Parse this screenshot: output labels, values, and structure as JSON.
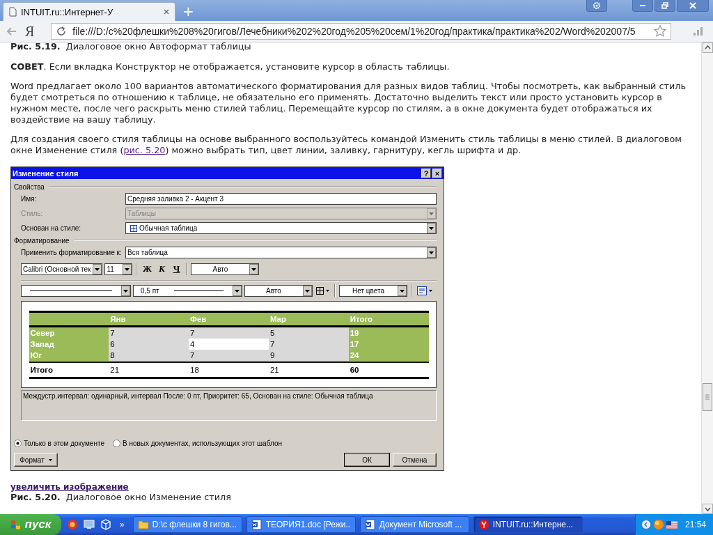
{
  "browser": {
    "tab": {
      "title": "INTUIT.ru::Интернет-У",
      "selected": true
    },
    "new_tab": "+",
    "logo": "Я",
    "address": "file:///D:/c%20флешки%208%20гигов/Лечебники%202%20год%205%20сем/1%20год/практика/практика%202/Word%202007/5"
  },
  "article": {
    "top_caption": {
      "number": "Рис. 5.19.",
      "text": "Диалоговое окно Автоформат таблицы"
    },
    "paragraphs": [
      {
        "text": "**СОВЕТ**. Если вкладка Конструктор не отображается, установите курсор в область таблицы."
      },
      {
        "text": "Word предлагает около 100 вариантов автоматического форматирования для разных видов таблиц. Чтобы посмотреть, как выбранный стиль будет смотреться по отношению к таблице, не обязательно его применять. Достаточно выделить текст или просто установить курсор в нужном месте, после чего раскрыть меню стилей таблиц. Перемещайте курсор по стилям, а в окне документа будет отображаться их воздействие на вашу таблицу."
      },
      {
        "text": "Для создания своего стиля таблицы на основе выбранного воспользуйтесь командой Изменить стиль таблицы в меню стилей. В диалоговом окне Изменение стиля (",
        "link": "рис. 5.20",
        "after": ") можно выбрать тип, цвет линии, заливку, гарнитуру, кегль шрифта и др."
      }
    ],
    "dialog": {
      "title": "Изменение стиля",
      "help": "?",
      "close": "×",
      "properties_section": "Свойства",
      "fields": [
        {
          "label": "Имя:",
          "value": "Средняя заливка 2 - Акцент 3",
          "kind": "text",
          "disabled": false
        },
        {
          "label": "Стиль:",
          "value": "Таблицы",
          "kind": "dropdown",
          "disabled": true
        },
        {
          "label": "Основан на стиле:",
          "value": "Обычная таблица",
          "kind": "dropdown",
          "disabled": false
        }
      ],
      "formatting_section": "Форматирование",
      "apply_to": {
        "label": "Применить форматирование к:",
        "value": "Вся таблица"
      },
      "font": "Calibri (Основной тек",
      "size": "11",
      "bold": "Ж",
      "italic": "К",
      "underline": "Ч",
      "font_color": "Авто",
      "line_weight": "0,5 пт",
      "line_color": "Авто",
      "fill": "Нет цвета",
      "preview": {
        "columns": [
          "Янв",
          "Фев",
          "Мар",
          "Итого"
        ],
        "rows": [
          {
            "label": "Север",
            "kind": "data",
            "cells": [
              {
                "value": "7",
                "selected": false
              },
              {
                "value": "7",
                "selected": false
              },
              {
                "value": "5",
                "selected": false
              }
            ],
            "total": "19"
          },
          {
            "label": "Запад",
            "kind": "data",
            "cells": [
              {
                "value": "6",
                "selected": false
              },
              {
                "value": "4",
                "selected": true
              },
              {
                "value": "7",
                "selected": false
              }
            ],
            "total": "17"
          },
          {
            "label": "Юг",
            "kind": "data",
            "cells": [
              {
                "value": "8",
                "selected": false
              },
              {
                "value": "7",
                "selected": false
              },
              {
                "value": "9",
                "selected": false
              }
            ],
            "total": "24"
          },
          {
            "label": "Итого",
            "kind": "total",
            "cells": [
              "21",
              "18",
              "21"
            ],
            "total": "60"
          }
        ]
      },
      "description": "Междустр.интервал:  одинарный, интервал После:  0 пт, Приоритет: 65, Основан на стиле: Обычная таблица",
      "radios": [
        {
          "label": "Только в этом документе",
          "selected": true
        },
        {
          "label": "В новых документах, использующих этот шаблон",
          "selected": false
        }
      ],
      "format_button": "Формат",
      "ok": "ОК",
      "cancel": "Отмена"
    },
    "enlarge_link": "увеличить изображение",
    "bottom_caption": {
      "number": "Рис. 5.20.",
      "text": "Диалоговое окно Изменение стиля"
    }
  },
  "taskbar": {
    "start": "пуск",
    "more": "»",
    "tasks": [
      {
        "label": "D:\\c флешки 8 гигов...",
        "kind": "folder",
        "selected": false
      },
      {
        "label": "ТЕОРИЯ1.doc [Режи...",
        "kind": "document",
        "selected": false
      },
      {
        "label": "Документ Microsoft ...",
        "kind": "document",
        "selected": false
      },
      {
        "label": "INTUIT.ru::Интерне...",
        "kind": "browser",
        "selected": true
      }
    ],
    "clock": "21:54"
  }
}
